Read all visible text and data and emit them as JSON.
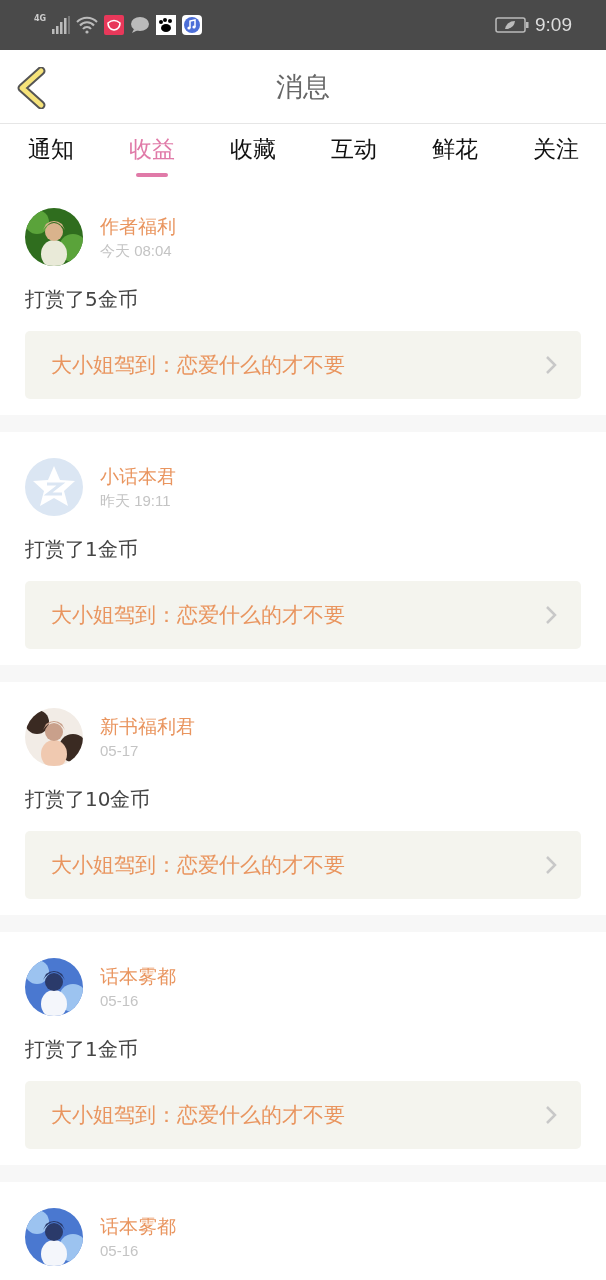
{
  "status_bar": {
    "network": "4G",
    "time": "9:09"
  },
  "header": {
    "title": "消息"
  },
  "tabs": [
    {
      "label": "通知",
      "selected": false
    },
    {
      "label": "收益",
      "selected": true
    },
    {
      "label": "收藏",
      "selected": false
    },
    {
      "label": "互动",
      "selected": false
    },
    {
      "label": "鲜花",
      "selected": false
    },
    {
      "label": "关注",
      "selected": false
    }
  ],
  "messages": [
    {
      "name": "作者福利",
      "time": "今天 08:04",
      "text": "打赏了5金币",
      "book": "大小姐驾到：恋爱什么的才不要"
    },
    {
      "avatar": {
        "kind": "default"
      },
      "name": "小话本君",
      "time": "昨天 19:11",
      "text": "打赏了1金币",
      "book": "大小姐驾到：恋爱什么的才不要"
    },
    {
      "name": "新书福利君",
      "time": "05-17",
      "text": "打赏了10金币",
      "book": "大小姐驾到：恋爱什么的才不要"
    },
    {
      "name": "话本雾都",
      "time": "05-16",
      "text": "打赏了1金币",
      "book": "大小姐驾到：恋爱什么的才不要"
    },
    {
      "name": "话本雾都",
      "time": "05-16"
    }
  ]
}
